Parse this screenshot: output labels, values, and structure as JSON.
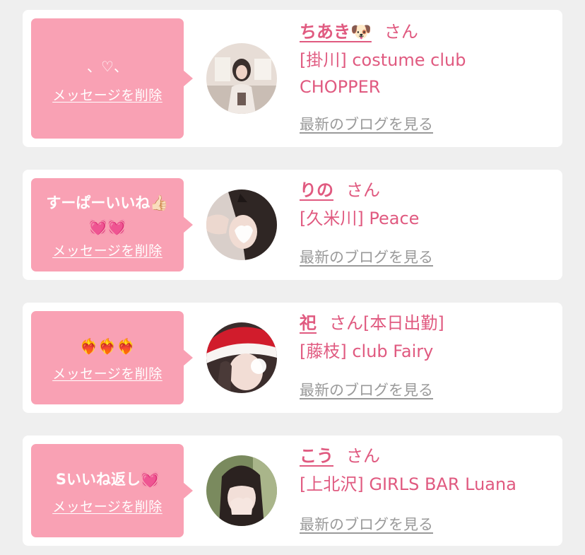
{
  "common": {
    "delete_label": "メッセージを削除",
    "san_label": "さん",
    "blog_label": "最新のブログを見る"
  },
  "cards": [
    {
      "message": "、♡、",
      "name": "ちあき🐶",
      "suffix": "",
      "shop": "[掛川] costume club CHOPPER"
    },
    {
      "message": "すーぱーいいね👍🏻\n💓💓",
      "name": "りの",
      "suffix": "",
      "shop": "[久米川] Peace"
    },
    {
      "message": "❤️‍🔥❤️‍🔥❤️‍🔥",
      "name": "祀",
      "suffix": "[本日出勤]",
      "shop": "[藤枝] club Fairy"
    },
    {
      "message": "Sいいね返し💓",
      "name": "こう",
      "suffix": "",
      "shop": "[上北沢] GIRLS BAR Luana"
    }
  ],
  "colors": {
    "background": "#efefef",
    "card": "#ffffff",
    "bubble": "#f9a1b4",
    "accent": "#e05a80",
    "blog_link": "#9a9a9a"
  }
}
